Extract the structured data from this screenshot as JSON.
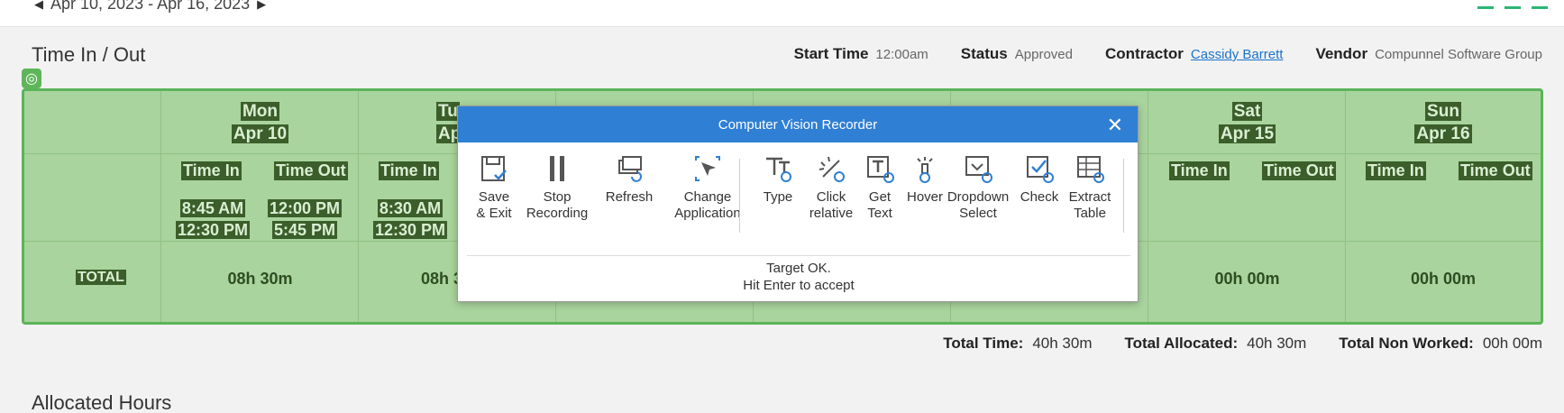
{
  "topbar": {
    "date_range": "Apr 10, 2023 - Apr 16, 2023",
    "prev_icon": "caret-left-icon",
    "next_icon": "caret-right-icon",
    "accent_color": "#2bb673"
  },
  "header": {
    "title": "Time In / Out",
    "start_time_label": "Start Time",
    "start_time_value": "12:00am",
    "status_label": "Status",
    "status_value": "Approved",
    "contractor_label": "Contractor",
    "contractor_value": "Cassidy Barrett",
    "vendor_label": "Vendor",
    "vendor_value": "Compunnel Software Group"
  },
  "grid": {
    "highlight_color": "#a9d49d",
    "border_color": "#5bb45a",
    "days": [
      {
        "day": "Mon",
        "date": "Apr 10",
        "time_in_label": "Time In",
        "time_out_label": "Time Out",
        "in1": "8:45 AM",
        "out1": "12:00 PM",
        "in2": "12:30 PM",
        "out2": "5:45 PM",
        "total": "08h 30m"
      },
      {
        "day": "Tu",
        "date": "Apr",
        "time_in_label": "Time In",
        "in1": "8:30 AM",
        "in2": "12:30 PM",
        "total": "08h 3"
      },
      {
        "day": "Sat",
        "date": "Apr 15",
        "time_in_label": "Time In",
        "time_out_label": "Time Out",
        "total": "00h 00m"
      },
      {
        "day": "Sun",
        "date": "Apr 16",
        "time_in_label": "Time In",
        "time_out_label": "Time Out",
        "total": "00h 00m"
      }
    ],
    "total_label": "TOTAL"
  },
  "totals": {
    "total_time_label": "Total Time:",
    "total_time_value": "40h 30m",
    "total_allocated_label": "Total Allocated:",
    "total_allocated_value": "40h 30m",
    "total_non_worked_label": "Total Non Worked:",
    "total_non_worked_value": "00h 00m"
  },
  "allocated": {
    "title": "Allocated Hours"
  },
  "dialog": {
    "title": "Computer Vision Recorder",
    "title_color": "#2f7fd4",
    "tools": [
      {
        "line1": "Save",
        "line2": "& Exit",
        "icon": "save-icon"
      },
      {
        "line1": "Stop",
        "line2": "Recording",
        "icon": "pause-icon"
      },
      {
        "line1": "Refresh",
        "line2": "",
        "icon": "refresh-icon"
      },
      {
        "line1": "Change",
        "line2": "Application",
        "icon": "cursor-icon"
      },
      {
        "line1": "Type",
        "line2": "",
        "icon": "type-icon"
      },
      {
        "line1": "Click",
        "line2": "relative",
        "icon": "click-relative-icon"
      },
      {
        "line1": "Get",
        "line2": "Text",
        "icon": "get-text-icon"
      },
      {
        "line1": "Hover",
        "line2": "",
        "icon": "hover-icon"
      },
      {
        "line1": "Dropdown",
        "line2": "Select",
        "icon": "dropdown-icon"
      },
      {
        "line1": "Check",
        "line2": "",
        "icon": "check-icon"
      },
      {
        "line1": "Extract",
        "line2": "Table",
        "icon": "extract-table-icon"
      }
    ],
    "status_line1": "Target OK.",
    "status_line2": "Hit Enter to accept"
  }
}
